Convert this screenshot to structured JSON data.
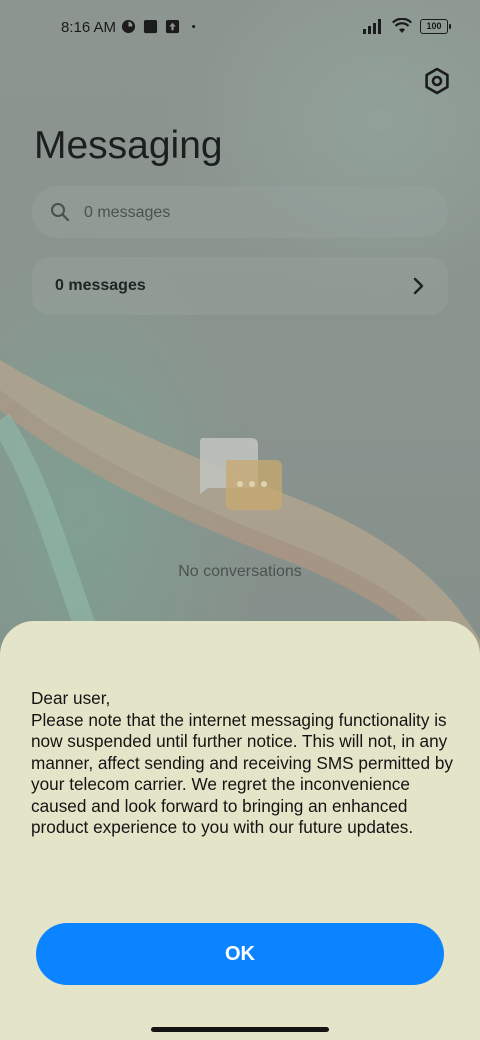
{
  "status_bar": {
    "time": "8:16 AM",
    "battery": "100",
    "icons": [
      "media-icon",
      "stop-icon",
      "upload-icon",
      "dot-icon",
      "signal-icon",
      "wifi-icon",
      "battery-icon"
    ]
  },
  "header": {
    "title": "Messaging",
    "settings_icon": "gear-icon"
  },
  "search": {
    "placeholder": "0 messages",
    "icon": "search-icon"
  },
  "messages_row": {
    "label": "0 messages",
    "icon": "chevron-right-icon"
  },
  "empty_state": {
    "icon": "conversation-icon",
    "text": "No conversations"
  },
  "dialog": {
    "greeting": "Dear user,",
    "body": "Please note that the internet messaging functionality is now suspended until further notice. This will not, in any manner, affect sending and receiving SMS permitted by your telecom carrier. We regret the inconvenience caused and look forward to bringing an enhanced product experience to you with our future updates.",
    "ok_label": "OK"
  },
  "colors": {
    "accent": "#0d84ff",
    "sheet": "#e4e5c8",
    "overlay": "#8f968f"
  }
}
